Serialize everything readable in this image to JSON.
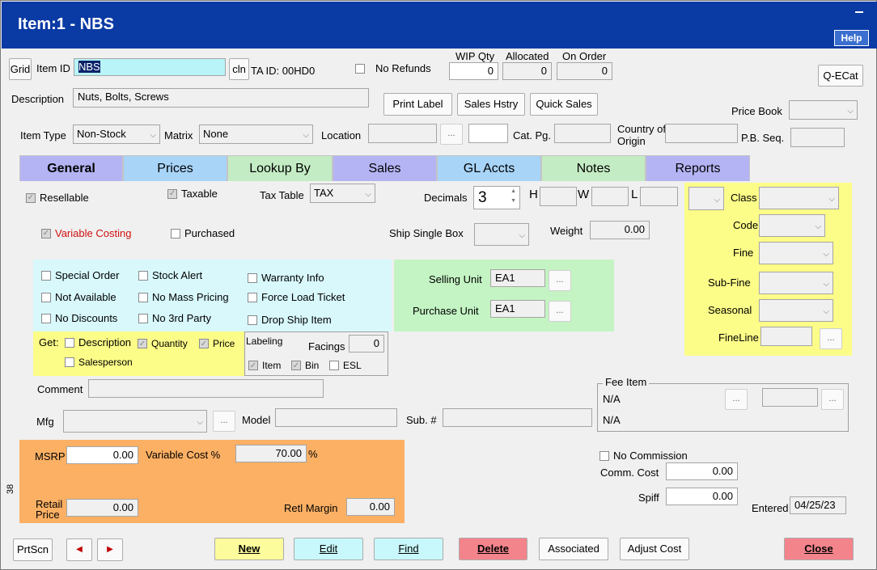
{
  "window": {
    "title": "Item:1 - NBS",
    "help": "Help",
    "minimize": "–"
  },
  "top": {
    "grid": "Grid",
    "item_id_label": "Item ID",
    "item_id": "NBS",
    "cln": "cln",
    "ta_id": "TA ID:  00HD0",
    "no_refunds": "No Refunds",
    "wip_label": "WIP Qty",
    "wip": "0",
    "allocated_label": "Allocated",
    "allocated": "0",
    "on_order_label": "On Order",
    "on_order": "0",
    "qecat": "Q-ECat",
    "description_label": "Description",
    "description": "Nuts, Bolts, Screws",
    "print_label": "Print Label",
    "sales_hstry": "Sales Hstry",
    "quick_sales": "Quick Sales",
    "price_book_label": "Price Book",
    "item_type_label": "Item Type",
    "item_type": "Non-Stock",
    "matrix_label": "Matrix",
    "matrix": "None",
    "location_label": "Location",
    "dots": "...",
    "cat_pg_label": "Cat. Pg.",
    "country_label1": "Country of",
    "country_label2": "Origin",
    "pb_seq_label": "P.B. Seq."
  },
  "tabs": [
    {
      "label": "General",
      "color": "#b4b4f4"
    },
    {
      "label": "Prices",
      "color": "#a8d4f8"
    },
    {
      "label": "Lookup By",
      "color": "#c4ecc4"
    },
    {
      "label": "Sales",
      "color": "#b4b4f4"
    },
    {
      "label": "GL Accts",
      "color": "#a8d4f8"
    },
    {
      "label": "Notes",
      "color": "#c4ecc4"
    },
    {
      "label": "Reports",
      "color": "#b4b4f4"
    }
  ],
  "general": {
    "resellable": "Resellable",
    "taxable": "Taxable",
    "tax_table_label": "Tax Table",
    "tax_table": "TAX",
    "decimals_label": "Decimals",
    "decimals": "3",
    "h": "H",
    "w": "W",
    "l": "L",
    "variable_costing": "Variable Costing",
    "purchased": "Purchased",
    "ship_single_box": "Ship Single Box",
    "weight_label": "Weight",
    "weight": "0.00",
    "special_order": "Special Order",
    "stock_alert": "Stock Alert",
    "warranty_info": "Warranty Info",
    "not_available": "Not Available",
    "no_mass_pricing": "No Mass Pricing",
    "force_load_ticket": "Force Load Ticket",
    "no_discounts": "No Discounts",
    "no_3rd_party": "No 3rd Party",
    "drop_ship_item": "Drop Ship Item",
    "get_label": "Get:",
    "get_description": "Description",
    "get_quantity": "Quantity",
    "get_price": "Price",
    "get_salesperson": "Salesperson",
    "labeling": "Labeling",
    "facings_label": "Facings",
    "facings": "0",
    "lab_item": "Item",
    "lab_bin": "Bin",
    "lab_esl": "ESL",
    "selling_unit_label": "Selling Unit",
    "selling_unit": "EA1",
    "purchase_unit_label": "Purchase Unit",
    "purchase_unit": "EA1",
    "class": "Class",
    "code": "Code",
    "fine": "Fine",
    "sub_fine": "Sub-Fine",
    "seasonal": "Seasonal",
    "fineline": "FineLine",
    "comment_label": "Comment",
    "fee_item_label": "Fee Item",
    "fee_na1": "N/A",
    "fee_na2": "N/A",
    "mfg_label": "Mfg",
    "model_label": "Model",
    "sub_label": "Sub. #",
    "msrp_label": "MSRP",
    "msrp": "0.00",
    "var_cost_label": "Variable Cost %",
    "var_cost": "70.00",
    "pct": "%",
    "retail_price_label1": "Retail",
    "retail_price_label2": "Price",
    "retail_price": "0.00",
    "retl_margin_label": "Retl Margin",
    "retl_margin": "0.00",
    "side_num": "38",
    "no_commission": "No Commission",
    "comm_cost_label": "Comm. Cost",
    "comm_cost": "0.00",
    "spiff_label": "Spiff",
    "spiff": "0.00",
    "entered_label": "Entered",
    "entered": "04/25/23"
  },
  "bottom": {
    "prtscn": "PrtScn",
    "prev": "◀",
    "next": "▶",
    "new": "New",
    "edit": "Edit",
    "find": "Find",
    "delete": "Delete",
    "associated": "Associated",
    "adjust_cost": "Adjust Cost",
    "close": "Close"
  }
}
